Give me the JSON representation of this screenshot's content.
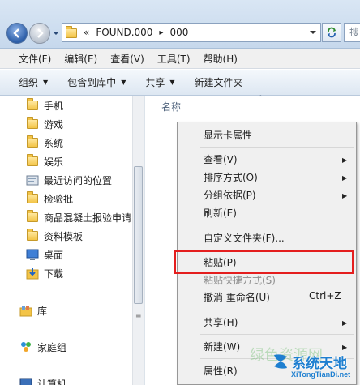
{
  "address": {
    "crumbs": [
      "«",
      "FOUND.000",
      "▸",
      "000"
    ],
    "search_placeholder": "搜"
  },
  "menubar": [
    "文件(F)",
    "编辑(E)",
    "查看(V)",
    "工具(T)",
    "帮助(H)"
  ],
  "toolbar": {
    "organize": "组织",
    "include": "包含到库中",
    "share": "共享",
    "new_folder": "新建文件夹"
  },
  "nav": {
    "items": [
      {
        "label": "手机",
        "icon": "folder-icon"
      },
      {
        "label": "游戏",
        "icon": "folder-icon"
      },
      {
        "label": "系统",
        "icon": "folder-icon"
      },
      {
        "label": "娱乐",
        "icon": "folder-icon"
      },
      {
        "label": "最近访问的位置",
        "icon": "recent-places-icon"
      },
      {
        "label": "检验批",
        "icon": "folder-icon"
      },
      {
        "label": "商品混凝土报验申请",
        "icon": "folder-icon"
      },
      {
        "label": "资料模板",
        "icon": "folder-icon"
      },
      {
        "label": "桌面",
        "icon": "desktop-icon"
      },
      {
        "label": "下载",
        "icon": "download-icon"
      }
    ],
    "library": "库",
    "homegroup": "家庭组",
    "computer": "计算机"
  },
  "content": {
    "column_name": "名称"
  },
  "context_menu": {
    "items": [
      {
        "label": "显示卡属性"
      },
      {
        "label": "查看(V)",
        "submenu": true
      },
      {
        "label": "排序方式(O)",
        "submenu": true
      },
      {
        "label": "分组依据(P)",
        "submenu": true
      },
      {
        "label": "刷新(E)"
      },
      {
        "label": "自定义文件夹(F)..."
      },
      {
        "label": "粘贴(P)"
      },
      {
        "label": "粘贴快捷方式(S)",
        "disabled": true
      },
      {
        "label": "撤消 重命名(U)",
        "shortcut": "Ctrl+Z"
      },
      {
        "label": "共享(H)",
        "submenu": true
      },
      {
        "label": "新建(W)",
        "submenu": true
      },
      {
        "label": "属性(R)"
      }
    ]
  },
  "watermark": {
    "cn": "系统天地",
    "en": "XiTongTianDi.net",
    "faint": "绿色资源网"
  },
  "colors": {
    "highlight_border": "#e41e1e",
    "watermark_blue": "#1e7fd0"
  }
}
